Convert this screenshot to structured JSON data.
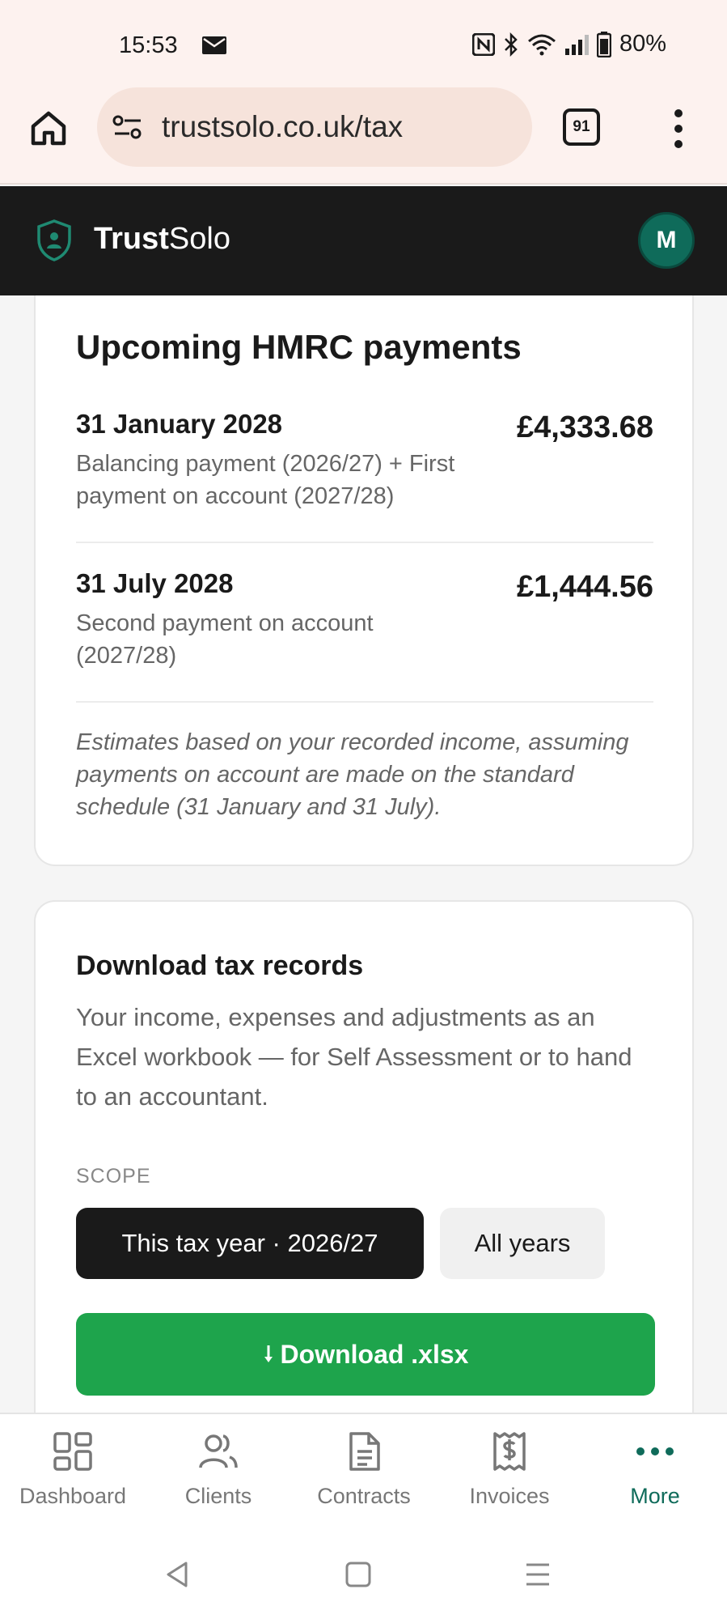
{
  "status_bar": {
    "time": "15:53",
    "battery": "80%",
    "icons": [
      "mail-icon",
      "nfc-icon",
      "bluetooth-icon",
      "wifi-icon",
      "signal-icon",
      "battery-icon"
    ]
  },
  "browser": {
    "url": "trustsolo.co.uk/tax",
    "tab_count": "91"
  },
  "app": {
    "brand_bold": "Trust",
    "brand_light": "Solo",
    "avatar_initial": "M",
    "accent_color": "#0f6b5a"
  },
  "payments_card": {
    "title": "Upcoming HMRC payments",
    "payments": [
      {
        "date": "31 January 2028",
        "description": "Balancing payment (2026/27) + First payment on account (2027/28)",
        "amount": "£4,333.68"
      },
      {
        "date": "31 July 2028",
        "description": "Second payment on account (2027/28)",
        "amount": "£1,444.56"
      }
    ],
    "note": "Estimates based on your recorded income, assuming payments on account are made on the standard schedule (31 January and 31 July)."
  },
  "download_card": {
    "title": "Download tax records",
    "description": "Your income, expenses and adjustments as an Excel workbook — for Self Assessment or to hand to an accountant.",
    "scope_label": "SCOPE",
    "scope_options": [
      {
        "label": "This tax year · 2026/27",
        "selected": true
      },
      {
        "label": "All years",
        "selected": false
      }
    ],
    "download_label": "Download .xlsx",
    "download_color": "#1ea44c"
  },
  "bottom_nav": {
    "items": [
      {
        "label": "Dashboard",
        "icon": "dashboard-icon"
      },
      {
        "label": "Clients",
        "icon": "users-icon"
      },
      {
        "label": "Contracts",
        "icon": "document-icon"
      },
      {
        "label": "Invoices",
        "icon": "receipt-icon"
      },
      {
        "label": "More",
        "icon": "more-dots-icon",
        "active": true
      }
    ]
  }
}
